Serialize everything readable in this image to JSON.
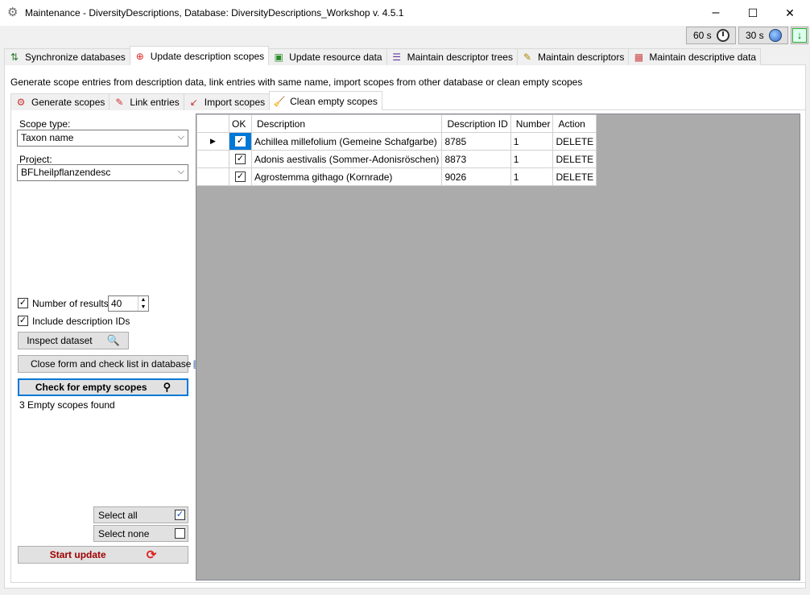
{
  "window": {
    "title": "Maintenance - DiversityDescriptions,  Database: DiversityDescriptions_Workshop    v. 4.5.1",
    "minimize": "–",
    "maximize": "☐",
    "close": "✕"
  },
  "timers": {
    "t1": "60 s",
    "t2": "30 s"
  },
  "main_tabs": [
    {
      "label": "Synchronize databases",
      "icon": "sync-icon"
    },
    {
      "label": "Update description scopes",
      "icon": "target-icon"
    },
    {
      "label": "Update resource data",
      "icon": "image-icon"
    },
    {
      "label": "Maintain descriptor trees",
      "icon": "tree-icon"
    },
    {
      "label": "Maintain descriptors",
      "icon": "descriptor-icon"
    },
    {
      "label": "Maintain descriptive data",
      "icon": "data-icon"
    }
  ],
  "description": "Generate scope entries from description data, link entries with same name, import scopes from other database or clean empty scopes",
  "sub_tabs": [
    {
      "label": "Generate scopes"
    },
    {
      "label": "Link entries"
    },
    {
      "label": "Import scopes"
    },
    {
      "label": "Clean empty scopes"
    }
  ],
  "left": {
    "scope_type_label": "Scope type:",
    "scope_type_value": "Taxon name",
    "project_label": "Project:",
    "project_value": "BFLheilpflanzendesc",
    "num_results_label": "Number of results:",
    "num_results_value": "40",
    "include_ids_label": "Include description IDs",
    "inspect_label": "Inspect dataset",
    "close_form_label": "Close form and check list in database",
    "check_label": "Check for empty scopes",
    "status": "3 Empty scopes found",
    "select_all": "Select all",
    "select_none": "Select none",
    "start_update": "Start update"
  },
  "grid": {
    "headers": [
      "OK",
      "Description",
      "Description ID",
      "Number",
      "Action"
    ],
    "rows": [
      {
        "ok": true,
        "description": "Achillea millefolium (Gemeine Schafgarbe)",
        "id": "8785",
        "number": "1",
        "action": "DELETE"
      },
      {
        "ok": true,
        "description": "Adonis aestivalis (Sommer-Adonisröschen)",
        "id": "8873",
        "number": "1",
        "action": "DELETE"
      },
      {
        "ok": true,
        "description": "Agrostemma githago (Kornrade)",
        "id": "9026",
        "number": "1",
        "action": "DELETE"
      }
    ]
  }
}
